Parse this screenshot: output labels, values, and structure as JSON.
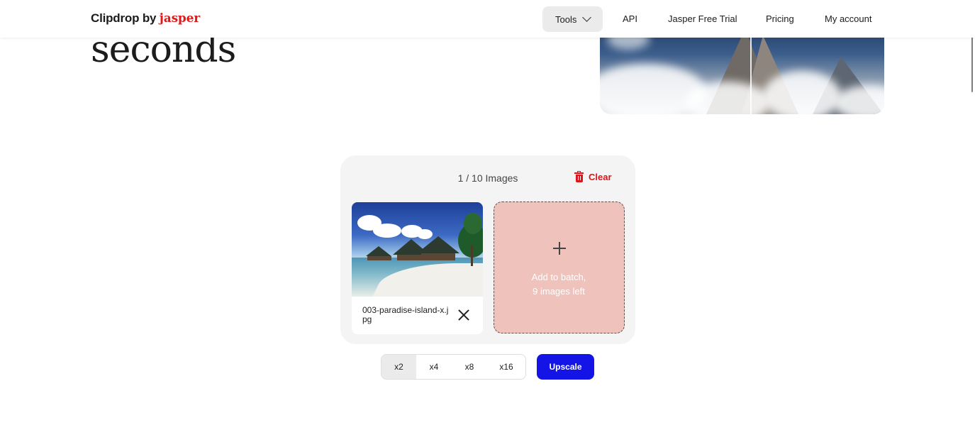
{
  "header": {
    "logo_brand": "Clipdrop",
    "logo_by": "by",
    "logo_partner": "jasper",
    "nav": {
      "tools": "Tools",
      "api": "API",
      "trial": "Jasper Free Trial",
      "pricing": "Pricing",
      "account": "My account"
    }
  },
  "hero": {
    "title_fragment": "seconds"
  },
  "batch": {
    "count": "1 / 10 Images",
    "clear_label": "Clear",
    "file": {
      "name": "003-paradise-island-x.jpg"
    },
    "add_zone": {
      "line1": "Add to batch,",
      "line2": "9 images left"
    }
  },
  "controls": {
    "scales": [
      "x2",
      "x4",
      "x8",
      "x16"
    ],
    "selected_scale": "x2",
    "upscale_label": "Upscale"
  },
  "colors": {
    "brand_red": "#e0191b",
    "clear_red": "#d8161b",
    "upscale_blue": "#1414e6",
    "drop_zone": "#f0c2bc"
  }
}
